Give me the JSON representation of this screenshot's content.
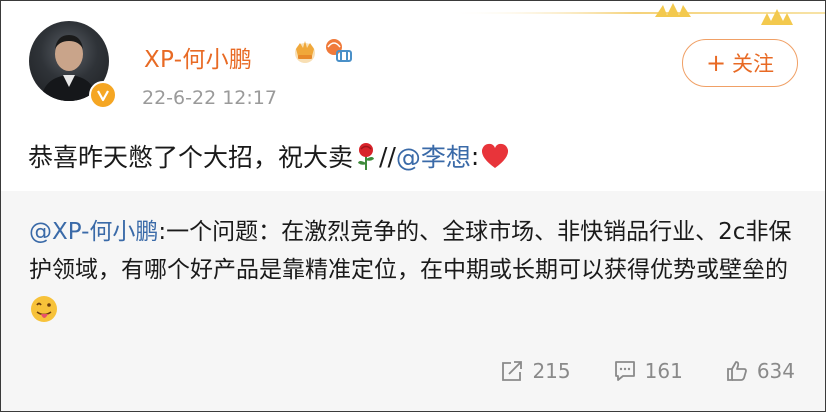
{
  "header": {
    "username": "XP-何小鹏",
    "timestamp": "22-6-22 12:17",
    "follow_label": "关注",
    "follow_plus": "+"
  },
  "post": {
    "text_before": "恭喜昨天憋了个大招，祝大卖",
    "separator": " //",
    "mention": "@李想",
    "after_mention": ":"
  },
  "retweet": {
    "author": "@XP-何小鹏",
    "content": ":一个问题：在激烈竞争的、全球市场、非快销品行业、2c非保护领域，有哪个好产品是靠精准定位，在中期或长期可以获得优势或壁垒的"
  },
  "stats": {
    "reposts": "215",
    "comments": "161",
    "likes": "634"
  },
  "colors": {
    "username": "#e86a24",
    "mention": "#3a6aa8",
    "muted": "#9a9a9a",
    "retweet_bg": "#f6f6f6"
  },
  "icons": [
    "crown-icon",
    "verified-badge-icon",
    "rose-icon",
    "heart-icon",
    "tongue-emoji-icon",
    "repost-icon",
    "comment-icon",
    "like-icon"
  ]
}
